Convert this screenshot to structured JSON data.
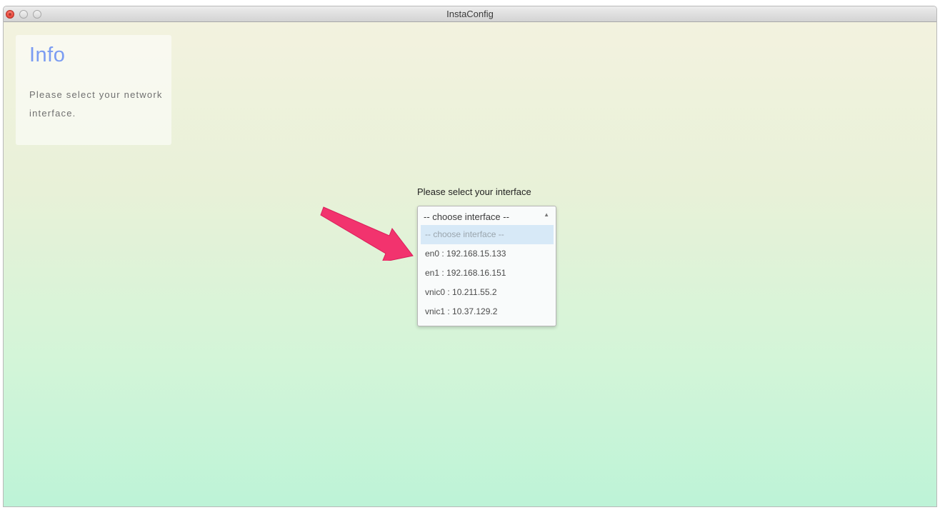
{
  "window": {
    "title": "InstaConfig"
  },
  "info": {
    "title": "Info",
    "text": "Please select your network interface."
  },
  "interface_select": {
    "label": "Please select your interface",
    "current_value": "-- choose interface --",
    "options": [
      "-- choose interface --",
      "en0 : 192.168.15.133",
      "en1 : 192.168.16.151",
      "vnic0 : 10.211.55.2",
      "vnic1 : 10.37.129.2"
    ],
    "highlighted_index": 0
  },
  "colors": {
    "info_title": "#7b9cf2",
    "annotation_arrow": "#f2336e",
    "option_highlight": "#d7e9f7"
  }
}
